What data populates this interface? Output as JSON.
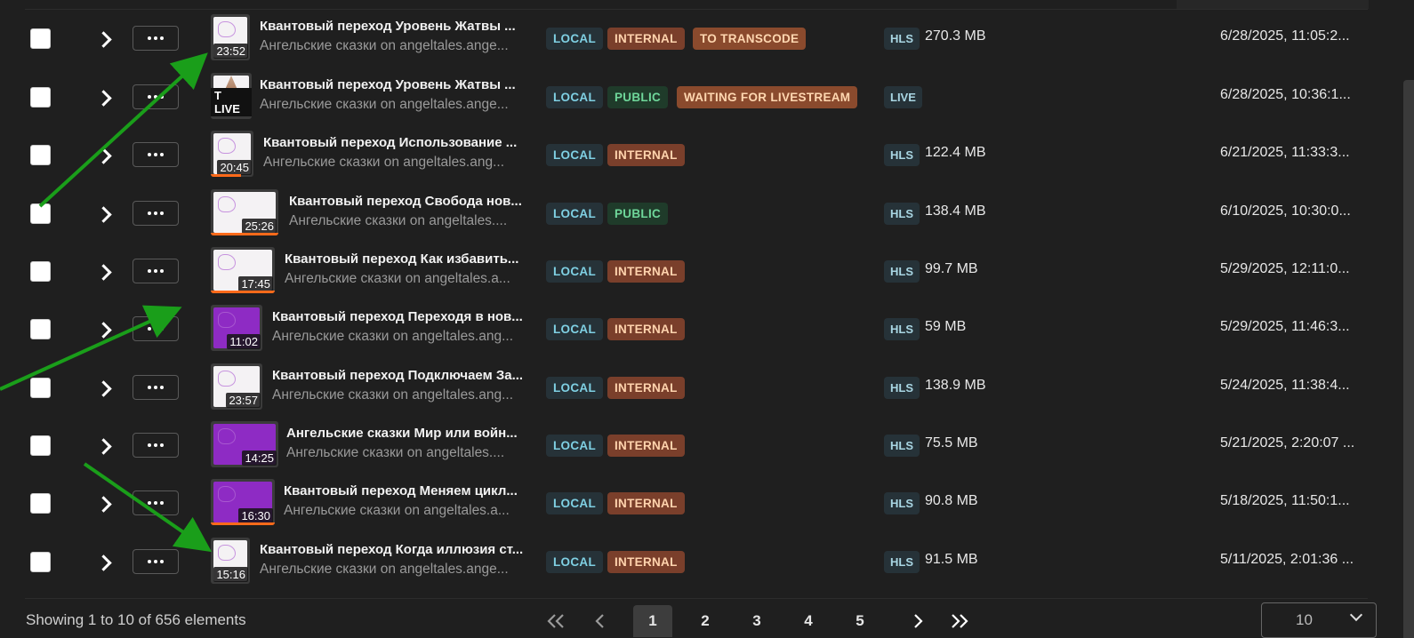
{
  "rows": [
    {
      "title": "Квантовый переход Уровень Жатвы ...",
      "subtitle": "Ангельские сказки on angeltales.ange...",
      "tags": [
        {
          "label": "LOCAL",
          "kind": "local"
        },
        {
          "label": "INTERNAL",
          "kind": "internal"
        },
        {
          "label": "TO TRANSCODE",
          "kind": "orange"
        }
      ],
      "format": "HLS",
      "size": "270.3 MB",
      "date": "6/28/2025, 11:05:2...",
      "duration": "23:52",
      "progress": 0
    },
    {
      "title": "Квантовый переход Уровень Жатвы ...",
      "subtitle": "Ангельские сказки on angeltales.ange...",
      "tags": [
        {
          "label": "LOCAL",
          "kind": "local"
        },
        {
          "label": "PUBLIC",
          "kind": "public"
        },
        {
          "label": "WAITING FOR LIVESTREAM",
          "kind": "orange"
        }
      ],
      "format": "LIVE",
      "size": "",
      "date": "6/28/2025, 10:36:1...",
      "duration": "LIVE",
      "progress": 0
    },
    {
      "title": "Квантовый переход Использование ...",
      "subtitle": "Ангельские сказки on angeltales.ang...",
      "tags": [
        {
          "label": "LOCAL",
          "kind": "local"
        },
        {
          "label": "INTERNAL",
          "kind": "internal"
        }
      ],
      "format": "HLS",
      "size": "122.4 MB",
      "date": "6/21/2025, 11:33:3...",
      "duration": "20:45",
      "progress": 0.7
    },
    {
      "title": "Квантовый переход Свобода нов...",
      "subtitle": "Ангельские сказки on angeltales....",
      "tags": [
        {
          "label": "LOCAL",
          "kind": "local"
        },
        {
          "label": "PUBLIC",
          "kind": "public"
        }
      ],
      "format": "HLS",
      "size": "138.4 MB",
      "date": "6/10/2025, 10:30:0...",
      "duration": "25:26",
      "progress": 1
    },
    {
      "title": "Квантовый переход Как избавить...",
      "subtitle": "Ангельские сказки on angeltales.a...",
      "tags": [
        {
          "label": "LOCAL",
          "kind": "local"
        },
        {
          "label": "INTERNAL",
          "kind": "internal"
        }
      ],
      "format": "HLS",
      "size": "99.7 MB",
      "date": "5/29/2025, 12:11:0...",
      "duration": "17:45",
      "progress": 1
    },
    {
      "title": "Квантовый переход Переходя в нов...",
      "subtitle": "Ангельские сказки on angeltales.ang...",
      "tags": [
        {
          "label": "LOCAL",
          "kind": "local"
        },
        {
          "label": "INTERNAL",
          "kind": "internal"
        }
      ],
      "format": "HLS",
      "size": "59 MB",
      "date": "5/29/2025, 11:46:3...",
      "duration": "11:02",
      "progress": 0
    },
    {
      "title": "Квантовый переход Подключаем За...",
      "subtitle": "Ангельские сказки on angeltales.ang...",
      "tags": [
        {
          "label": "LOCAL",
          "kind": "local"
        },
        {
          "label": "INTERNAL",
          "kind": "internal"
        }
      ],
      "format": "HLS",
      "size": "138.9 MB",
      "date": "5/24/2025, 11:38:4...",
      "duration": "23:57",
      "progress": 0
    },
    {
      "title": "Ангельские сказки Мир или войн...",
      "subtitle": "Ангельские сказки on angeltales....",
      "tags": [
        {
          "label": "LOCAL",
          "kind": "local"
        },
        {
          "label": "INTERNAL",
          "kind": "internal"
        }
      ],
      "format": "HLS",
      "size": "75.5 MB",
      "date": "5/21/2025, 2:20:07 ...",
      "duration": "14:25",
      "progress": 0
    },
    {
      "title": "Квантовый переход Меняем цикл...",
      "subtitle": "Ангельские сказки on angeltales.a...",
      "tags": [
        {
          "label": "LOCAL",
          "kind": "local"
        },
        {
          "label": "INTERNAL",
          "kind": "internal"
        }
      ],
      "format": "HLS",
      "size": "90.8 MB",
      "date": "5/18/2025, 11:50:1...",
      "duration": "16:30",
      "progress": 1
    },
    {
      "title": "Квантовый переход Когда иллюзия ст...",
      "subtitle": "Ангельские сказки on angeltales.ange...",
      "tags": [
        {
          "label": "LOCAL",
          "kind": "local"
        },
        {
          "label": "INTERNAL",
          "kind": "internal"
        }
      ],
      "format": "HLS",
      "size": "91.5 MB",
      "date": "5/11/2025, 2:01:36 ...",
      "duration": "15:16",
      "progress": 0
    }
  ],
  "footer": {
    "showing": "Showing 1 to 10 of 656 elements",
    "pages": [
      "1",
      "2",
      "3",
      "4",
      "5"
    ],
    "current_page": "1",
    "first": "«",
    "prev": "‹",
    "next": "›",
    "last": "»",
    "page_size": "10"
  },
  "colors": {
    "annotation_arrow": "#1a9e1a",
    "progress": "#ff6a1a"
  }
}
